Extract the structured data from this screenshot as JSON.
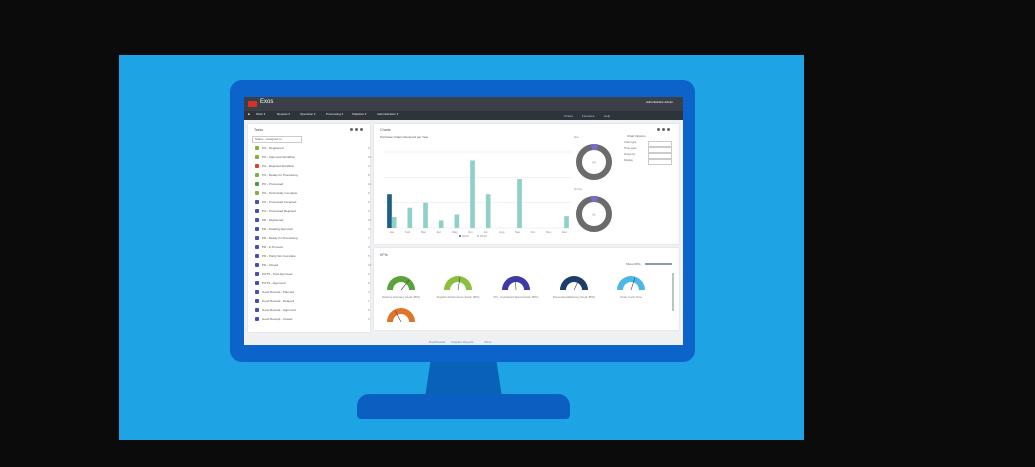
{
  "app": {
    "title": "Exos",
    "user": "Administrator Admin"
  },
  "menu": {
    "items": [
      "Work ▾",
      "Reports ▾",
      "Operation ▾",
      "Processing ▾",
      "Statistics ▾",
      "Administration ▾"
    ],
    "topright": [
      "Orders",
      "Favorites",
      "Help"
    ]
  },
  "left_panel": {
    "title": "Tasks",
    "filter": "Status - Assigned to",
    "rows": [
      {
        "label": "PO - Registered",
        "color": "#7cb342",
        "count": "5"
      },
      {
        "label": "PO - Approved Workflow",
        "color": "#7cb342",
        "count": "12"
      },
      {
        "label": "PO - Rejected Workflow",
        "color": "#e53935",
        "count": "3"
      },
      {
        "label": "PO - Ready for Processing",
        "color": "#7cb342",
        "count": "8"
      },
      {
        "label": "PO - Processed",
        "color": "#43a047",
        "count": "14"
      },
      {
        "label": "PO - Technically Complete",
        "color": "#7cb342",
        "count": "6"
      },
      {
        "label": "PO - Processed Accepted",
        "color": "#3f51b5",
        "count": "9"
      },
      {
        "label": "PO - Processed Rejected",
        "color": "#3f51b5",
        "count": "2"
      },
      {
        "label": "PR - Registered",
        "color": "#3f51b5",
        "count": "11"
      },
      {
        "label": "PR - Awaiting Approval",
        "color": "#3f51b5",
        "count": "4"
      },
      {
        "label": "PR - Ready for Processing",
        "color": "#3f51b5",
        "count": "7"
      },
      {
        "label": "PR - In Process",
        "color": "#3f51b5",
        "count": "3"
      },
      {
        "label": "PR - Partly Not Complete",
        "color": "#3f51b5",
        "count": "5"
      },
      {
        "label": "PR - Closed",
        "color": "#3f51b5",
        "count": "16"
      },
      {
        "label": "POTS - Post Approved",
        "color": "#3f51b5",
        "count": "2"
      },
      {
        "label": "POTS - Approved",
        "color": "#3f51b5",
        "count": "8"
      },
      {
        "label": "Good Receipt - Planned",
        "color": "#3f51b5",
        "count": "4"
      },
      {
        "label": "Good Receipt - Delayed",
        "color": "#3f51b5",
        "count": "1"
      },
      {
        "label": "Good Receipt - Approved",
        "color": "#3f51b5",
        "count": "6"
      },
      {
        "label": "Good Receipt - Closed",
        "color": "#3f51b5",
        "count": "3"
      }
    ]
  },
  "chart_panel": {
    "title": "Charts",
    "subtitle": "Purchase Orders Received per Year"
  },
  "chart_data": {
    "type": "bar",
    "categories": [
      "Jan",
      "Feb",
      "Mar",
      "Apr",
      "May",
      "Jun",
      "Jul",
      "Aug",
      "Sep",
      "Oct",
      "Nov",
      "Dec"
    ],
    "series": [
      {
        "name": "2013",
        "color": "#1f5f86",
        "values": [
          40,
          0,
          0,
          0,
          0,
          0,
          0,
          0,
          0,
          0,
          0,
          0
        ]
      },
      {
        "name": "2014",
        "color": "#8fd1c9",
        "values": [
          13,
          24,
          30,
          9,
          16,
          80,
          40,
          0,
          58,
          0,
          0,
          14
        ]
      }
    ],
    "ylim": [
      0,
      90
    ],
    "yticks": [
      "",
      "",
      "",
      ""
    ],
    "legend": "bottom"
  },
  "donuts": [
    {
      "label": "Net",
      "value": "84"
    },
    {
      "label": "Gross",
      "value": "61"
    }
  ],
  "form": {
    "title": "Chart Options",
    "rows": [
      "Chart type",
      "Time span",
      "Group by",
      "Display"
    ]
  },
  "kpi_panel": {
    "title": "KPIs",
    "toggle_label": "Show KPIs",
    "gauges": [
      {
        "label": "Delivery Accuracy (Goal: 95%)",
        "color": "#5aa33b",
        "value": 0.72
      },
      {
        "label": "Supplier Performance (Goal: 90%)",
        "color": "#8cbf3f",
        "value": 0.55
      },
      {
        "label": "PO - Contracted Spend (Goal: 80%)",
        "color": "#3d3aa8",
        "value": 0.48
      },
      {
        "label": "Processing Efficiency (Goal: 85%)",
        "color": "#1c3e68",
        "value": 0.64
      },
      {
        "label": "Order Cycle Time",
        "color": "#4cb8e6",
        "value": 0.6
      },
      {
        "label": "",
        "color": "#e07429",
        "value": 0.35
      }
    ]
  },
  "bottom_tabs": [
    "Dashboards",
    "Supplier Reports",
    "Inbox"
  ]
}
